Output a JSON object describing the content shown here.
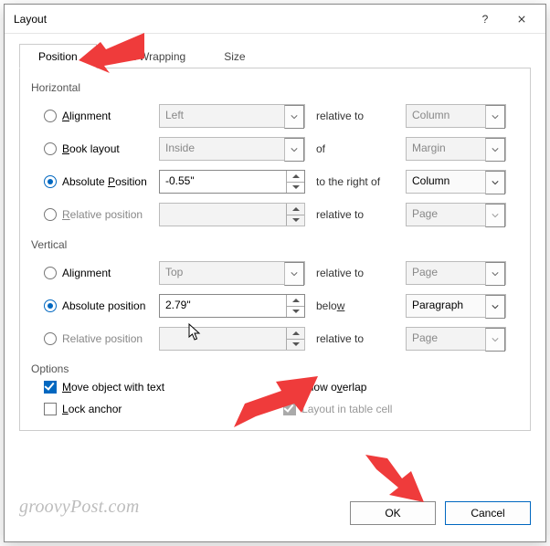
{
  "window": {
    "title": "Layout"
  },
  "tabs": {
    "position": "Position",
    "wrapping": "Text Wrapping",
    "size": "Size"
  },
  "groups": {
    "horizontal": "Horizontal",
    "vertical": "Vertical",
    "options": "Options"
  },
  "rel": {
    "relative_to": "relative to",
    "of": "of",
    "to_right_of": "to the right of",
    "below": "below"
  },
  "radio": {
    "alignment": "Alignment",
    "book_layout": "Book layout",
    "absolute_position": "Absolute position",
    "relative_position": "Relative position"
  },
  "underline": {
    "alignment": "A",
    "book_b": "B",
    "absolute_p": "P",
    "relative_r": "R",
    "move_m": "M",
    "lock_l": "L",
    "allow_v": "v",
    "below_w": "w"
  },
  "horizontal": {
    "alignment": {
      "value": "Left",
      "target": "Column"
    },
    "book": {
      "value": "Inside",
      "target": "Margin"
    },
    "absolute": {
      "value": "-0.55\"",
      "target": "Column"
    },
    "relative": {
      "value": "",
      "target": "Page"
    }
  },
  "vertical": {
    "alignment": {
      "value": "Top",
      "target": "Page"
    },
    "absolute": {
      "value": "2.79\"",
      "target": "Paragraph"
    },
    "relative": {
      "value": "",
      "target": "Page"
    }
  },
  "options": {
    "move_with_text": "Move object with text",
    "lock_anchor": "Lock anchor",
    "allow_overlap": "Allow overlap",
    "layout_in_cell": "Layout in table cell"
  },
  "buttons": {
    "ok": "OK",
    "cancel": "Cancel"
  },
  "watermark": "groovyPost.com"
}
